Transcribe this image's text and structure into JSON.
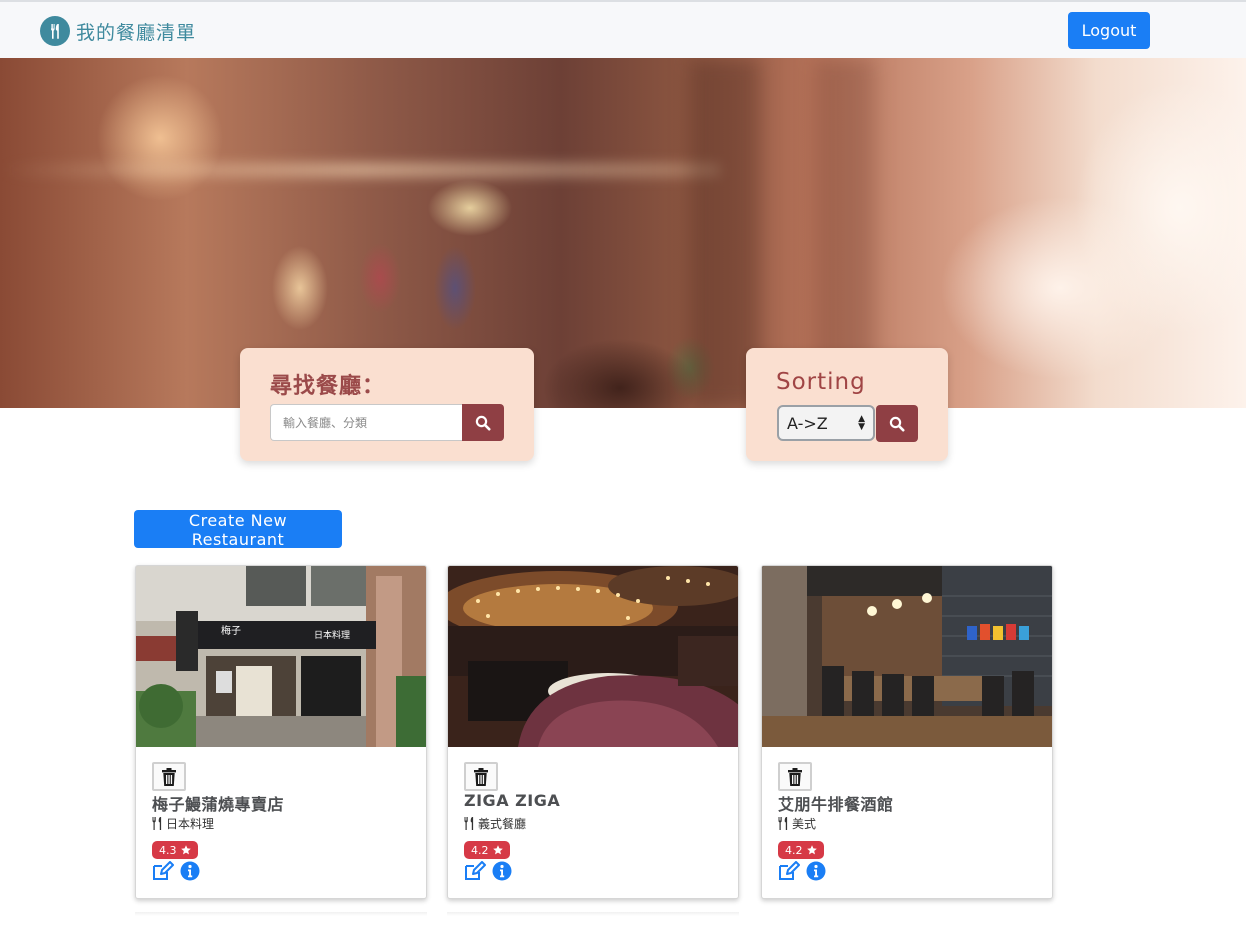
{
  "navbar": {
    "brand": "我的餐廳清單",
    "brand_icon": "utensils-icon",
    "logout_label": "Logout",
    "accent_color": "#1a7ef5"
  },
  "search": {
    "title": "尋找餐廳：",
    "placeholder": "輸入餐廳、分類",
    "button_icon": "search-icon"
  },
  "sorting": {
    "title": "Sorting",
    "selected": "A->Z",
    "button_icon": "search-icon"
  },
  "create_label": "Create New Restaurant",
  "restaurants": [
    {
      "name": "梅子鰻蒲燒專賣店",
      "category": "日本料理",
      "rating": "4.3"
    },
    {
      "name": "ZIGA ZIGA",
      "category": "義式餐廳",
      "rating": "4.2"
    },
    {
      "name": "艾朋牛排餐酒館",
      "category": "美式",
      "rating": "4.2"
    }
  ],
  "colors": {
    "panel_bg": "#fadfd0",
    "panel_title": "#9b4a4a",
    "search_button": "#8f3f44",
    "rating_badge": "#d63946"
  }
}
